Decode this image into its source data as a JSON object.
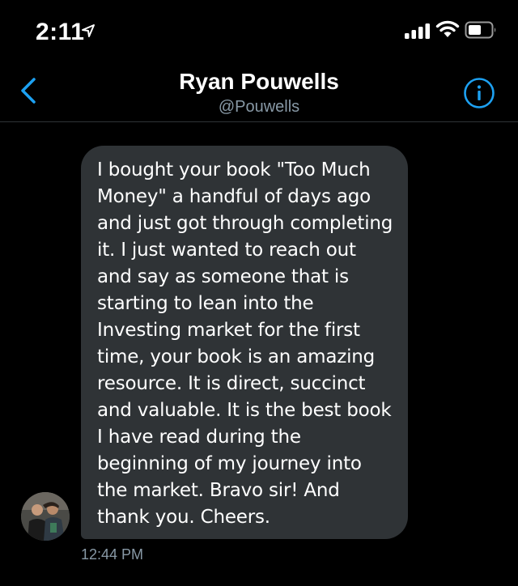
{
  "status_bar": {
    "time": "2:11"
  },
  "header": {
    "title": "Ryan Pouwells",
    "handle": "@Pouwells"
  },
  "conversation": {
    "message": {
      "text": "I bought your book \"Too Much Money\" a handful of days ago and just got through completing it. I just wanted to reach out and say as someone that is starting to lean into the Investing market for the first time, your book is an amazing resource. It is direct, succinct and valuable. It is the best book I have read during the beginning of my journey into the market. Bravo sir! And thank you. Cheers.",
      "timestamp": "12:44 PM"
    }
  },
  "icons": {
    "back": "chevron-left-icon",
    "info": "info-icon",
    "signal": "cellular-signal-icon",
    "wifi": "wifi-icon",
    "battery": "battery-icon",
    "location": "location-arrow-icon"
  },
  "colors": {
    "background": "#000000",
    "accent": "#1da1f2",
    "bubble": "#2f3336",
    "secondary_text": "#8899a6"
  }
}
